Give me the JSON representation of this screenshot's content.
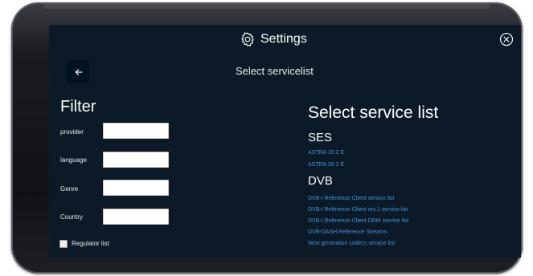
{
  "header": {
    "title": "Settings",
    "gear_icon": "gear-icon",
    "close_icon": "close-circle-icon"
  },
  "subheader": {
    "back_icon": "arrow-left-icon",
    "title": "Select servicelist"
  },
  "filter": {
    "heading": "Filter",
    "fields": [
      {
        "label": "provider",
        "value": ""
      },
      {
        "label": "language",
        "value": ""
      },
      {
        "label": "Genre",
        "value": ""
      },
      {
        "label": "Country",
        "value": ""
      }
    ],
    "regulator_checkbox": {
      "label": "Regulator list",
      "checked": false
    }
  },
  "service_list": {
    "heading": "Select service list",
    "groups": [
      {
        "name": "SES",
        "items": [
          "ASTRA 19.2 E",
          "ASTRA 28.2 E"
        ]
      },
      {
        "name": "DVB",
        "items": [
          "DVB-I Reference Client service list",
          "DVB-I Reference Client rev.1 service list",
          "DVB-I Reference Client DRM service list",
          "DVB-DASH Reference Streams",
          "Next generation codecs service list"
        ]
      }
    ]
  },
  "colors": {
    "screen_background": "#0b1a26",
    "link": "#3d95e8",
    "text": "#ffffff"
  }
}
